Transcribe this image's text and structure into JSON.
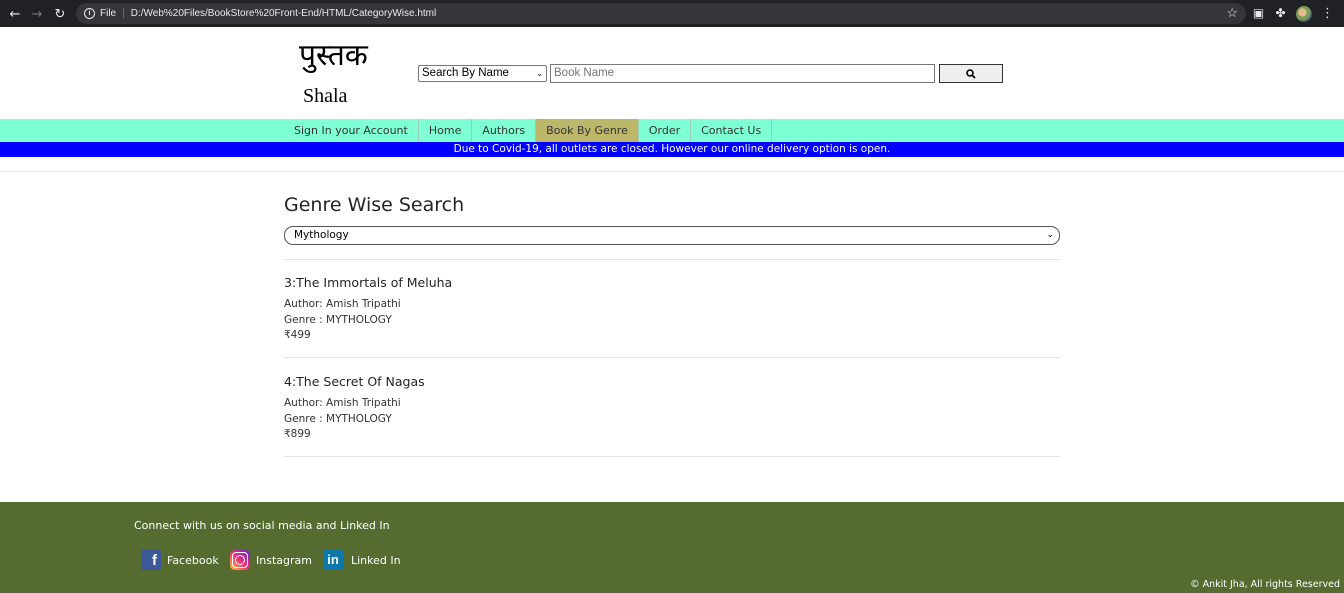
{
  "browser": {
    "file_label": "File",
    "url": "D:/Web%20Files/BookStore%20Front-End/HTML/CategoryWise.html"
  },
  "header": {
    "logo_hindi": "पुस्तक",
    "logo_english": "Shala",
    "search_mode": "Search By Name",
    "search_placeholder": "Book Name"
  },
  "nav": {
    "items": [
      {
        "label": "Sign In your Account"
      },
      {
        "label": "Home"
      },
      {
        "label": "Authors"
      },
      {
        "label": "Book By Genre",
        "active": true
      },
      {
        "label": "Order"
      },
      {
        "label": "Contact Us"
      }
    ]
  },
  "banner": "Due to Covid-19, all outlets are closed. However our online delivery option is open.",
  "main": {
    "title": "Genre Wise Search",
    "selected_genre": "Mythology",
    "books": [
      {
        "title": "3:The Immortals of Meluha",
        "author": "Author: Amish Tripathi",
        "genre": "Genre : MYTHOLOGY",
        "price": "₹499"
      },
      {
        "title": "4:The Secret Of Nagas",
        "author": "Author: Amish Tripathi",
        "genre": "Genre : MYTHOLOGY",
        "price": "₹899"
      }
    ]
  },
  "footer": {
    "heading": "Connect with us on social media and Linked In",
    "facebook": "Facebook",
    "instagram": "Instagram",
    "linkedin": "Linked In",
    "copyright": "© Ankit Jha, All rights Reserved"
  },
  "colors": {
    "nav_bg": "#7fffd4",
    "nav_active": "#bdb76b",
    "banner_bg": "#0000ff",
    "footer_bg": "#556b2f"
  }
}
